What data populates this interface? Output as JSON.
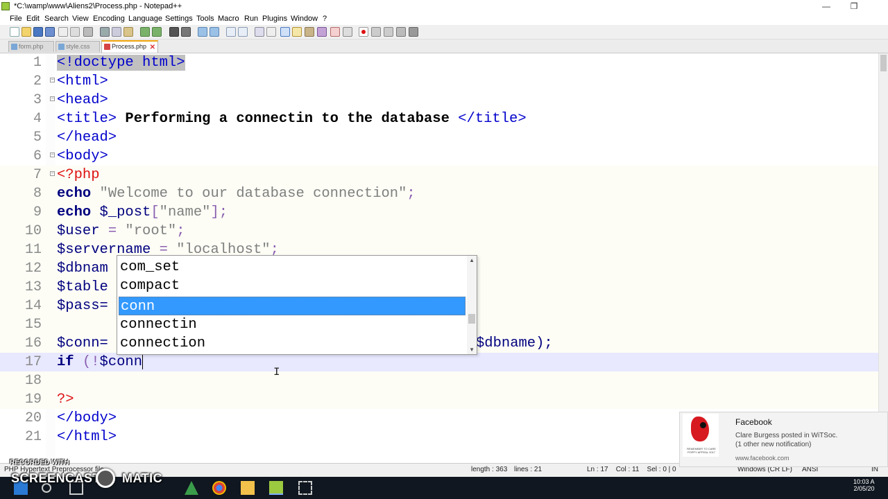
{
  "window": {
    "title": "*C:\\wamp\\www\\Aliens2\\Process.php - Notepad++",
    "minimize_glyph": "—",
    "maximize_glyph": "❐"
  },
  "menu": [
    "File",
    "Edit",
    "Search",
    "View",
    "Encoding",
    "Language",
    "Settings",
    "Tools",
    "Macro",
    "Run",
    "Plugins",
    "Window",
    "?"
  ],
  "tabs": [
    {
      "label": "form.php",
      "active": false
    },
    {
      "label": "style.css",
      "active": false
    },
    {
      "label": "Process.php",
      "active": true
    }
  ],
  "tab_close_glyph": "✕",
  "editor": {
    "lines": [
      {
        "n": "1"
      },
      {
        "n": "2"
      },
      {
        "n": "3"
      },
      {
        "n": "4"
      },
      {
        "n": "5"
      },
      {
        "n": "6"
      },
      {
        "n": "7"
      },
      {
        "n": "8"
      },
      {
        "n": "9"
      },
      {
        "n": "10"
      },
      {
        "n": "11"
      },
      {
        "n": "12"
      },
      {
        "n": "13"
      },
      {
        "n": "14"
      },
      {
        "n": "15"
      },
      {
        "n": "16"
      },
      {
        "n": "17"
      },
      {
        "n": "18"
      },
      {
        "n": "19"
      },
      {
        "n": "20"
      },
      {
        "n": "21"
      }
    ],
    "code": {
      "l1": "<!doctype html>",
      "l2": "<html>",
      "l3": "<head>",
      "l4_open": "<title>",
      "l4_text": " Performing a connectin to the database ",
      "l4_close": "</title>",
      "l5": "</head>",
      "l6": "<body>",
      "l7": "<?php",
      "l8_kw": "echo",
      "l8_str": "\"Welcome to our database connection\"",
      "l8_end": ";",
      "l9_kw": "echo",
      "l9_var": "$_post",
      "l9_b1": "[",
      "l9_str": "\"name\"",
      "l9_b2": "];",
      "l10_var": "$user",
      "l10_eq": " = ",
      "l10_str": "\"root\"",
      "l10_end": ";",
      "l11_var": "$servername",
      "l11_eq": " = ",
      "l11_str": "\"localhost\"",
      "l11_end": ";",
      "l12": "$dbnam",
      "l13": "$table",
      "l14": "$pass=",
      "l16_a": "$conn=",
      "l16_b": "$dbname);",
      "l17_kw": "if",
      "l17_paren": " (!",
      "l17_var": "$conn",
      "l19": "?>",
      "l20": "</body>",
      "l21": "</html>"
    }
  },
  "autocomplete": {
    "items": [
      "com_set",
      "compact",
      "conn",
      "connectin",
      "connection"
    ],
    "selected": "conn",
    "up_glyph": "▲",
    "down_glyph": "▼"
  },
  "status": {
    "language": "PHP Hypertext Preprocessor file",
    "length": "length : 363",
    "lines": "lines : 21",
    "position": "Ln : 17    Col : 11    Sel : 0 | 0",
    "eol": "Windows (CR LF)",
    "encoding": "ANSI",
    "mode": "IN"
  },
  "notification": {
    "app": "Facebook",
    "body_line1": "Clare Burgess posted in WiTSoc.",
    "body_line2": "(1 other new notification)",
    "source": "www.facebook.com",
    "image_caption": "REMEMBER TO CARE POPPY APPEAL 2017"
  },
  "watermark": {
    "small": "RECORDED WITH",
    "big": "SCREENCAST",
    "big2": "MATIC"
  },
  "taskbar": {
    "time": "10:03 A",
    "date": "2/05/20"
  },
  "colors": {
    "tab_accent": "#f0a30a",
    "selection": "#3399ff",
    "tag": "#0000cc",
    "php": "#dd1111",
    "taskbar": "#101720"
  }
}
